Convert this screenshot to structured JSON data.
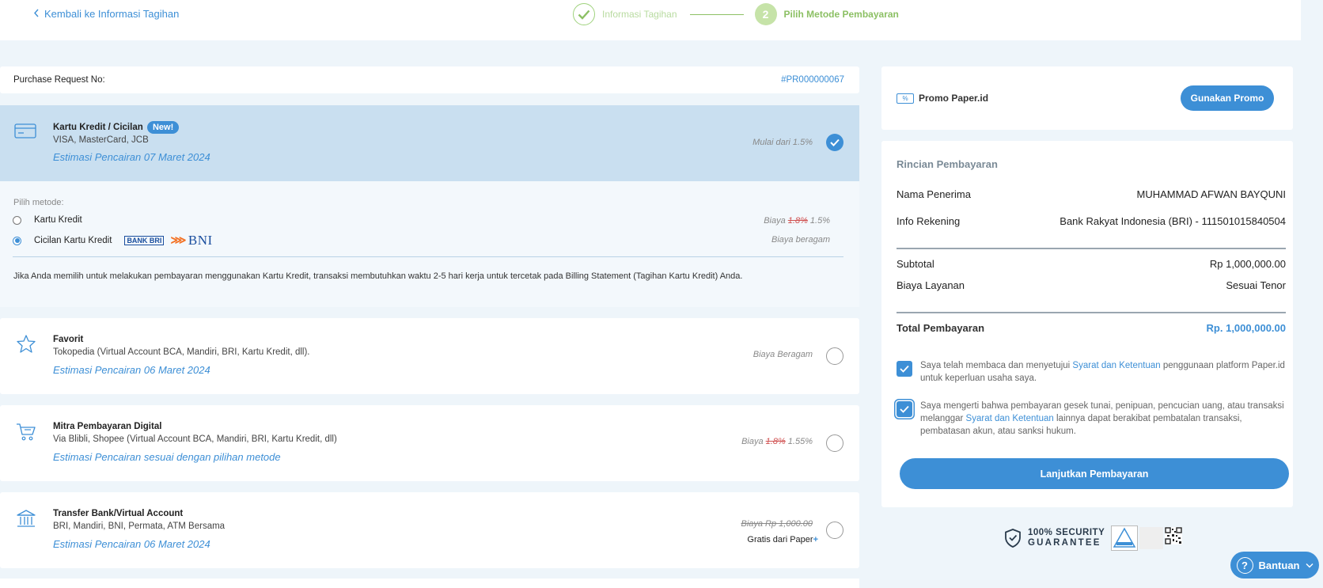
{
  "nav": {
    "back_label": "Kembali ke Informasi Tagihan",
    "step1_label": "Informasi Tagihan",
    "step2_number": "2",
    "step2_label": "Pilih Metode Pembayaran"
  },
  "purchase": {
    "label": "Purchase Request No:",
    "value": "#PR000000067"
  },
  "credit_card": {
    "title": "Kartu Kredit / Cicilan",
    "badge": "New!",
    "subtitle": "VISA, MasterCard, JCB",
    "estimate": "Estimasi Pencairan  07 Maret 2024",
    "fee": "Mulai dari 1.5%",
    "choose_label": "Pilih metode:",
    "option1_label": "Kartu Kredit",
    "option1_fee_prefix": "Biaya",
    "option1_fee_old": "1.8%",
    "option1_fee_new": "1.5%",
    "option2_label": "Cicilan Kartu Kredit",
    "option2_fee": "Biaya beragam",
    "bank_bri": "BANK BRI",
    "bank_bni": "BNI",
    "note": "Jika Anda memilih untuk melakukan pembayaran menggunakan Kartu Kredit, transaksi membutuhkan waktu 2-5 hari kerja untuk tercetak pada Billing Statement (Tagihan Kartu Kredit) Anda."
  },
  "methods": [
    {
      "title": "Favorit",
      "subtitle": "Tokopedia (Virtual Account BCA, Mandiri, BRI, Kartu Kredit, dll).",
      "estimate": "Estimasi Pencairan  06 Maret 2024",
      "fee": "Biaya Beragam"
    },
    {
      "title": "Mitra Pembayaran Digital",
      "subtitle": "Via Blibli, Shopee (Virtual Account BCA, Mandiri, BRI, Kartu Kredit, dll)",
      "estimate": "Estimasi Pencairan sesuai dengan pilihan metode",
      "fee_prefix": "Biaya",
      "fee_old": "1.8%",
      "fee_new": "1.55%"
    },
    {
      "title": "Transfer Bank/Virtual Account",
      "subtitle": "BRI, Mandiri, BNI, Permata, ATM Bersama",
      "estimate": "Estimasi Pencairan  06 Maret 2024",
      "fee_old": "Biaya Rp 1,000.00",
      "gratis_prefix": "Gratis",
      "gratis_suffix": "dari Paper",
      "gratis_plus": "+"
    }
  ],
  "promo": {
    "icon_text": "%",
    "label": "Promo Paper.id",
    "button": "Gunakan Promo"
  },
  "rincian": {
    "title": "Rincian Pembayaran",
    "recipient_label": "Nama Penerima",
    "recipient_value": "MUHAMMAD AFWAN BAYQUNI",
    "account_label": "Info Rekening",
    "account_value": "Bank Rakyat Indonesia (BRI) - 111501015840504",
    "subtotal_label": "Subtotal",
    "subtotal_value": "Rp 1,000,000.00",
    "service_label": "Biaya Layanan",
    "service_value": "Sesuai Tenor",
    "total_label": "Total Pembayaran",
    "total_value": "Rp. 1,000,000.00",
    "agree1_a": "Saya telah membaca dan menyetujui ",
    "agree1_link": "Syarat dan Ketentuan",
    "agree1_b": " penggunaan platform Paper.id untuk keperluan usaha saya.",
    "agree2_a": "Saya mengerti bahwa pembayaran gesek tunai, penipuan, pencucian uang, atau transaksi melanggar ",
    "agree2_link": "Syarat dan Ketentuan",
    "agree2_b": " lainnya dapat berakibat pembatalan transaksi, pembatasan akun, atau sanksi hukum.",
    "button": "Lanjutkan Pembayaran"
  },
  "security": {
    "line1": "100% SECURITY",
    "line2": "GUARANTEE"
  },
  "help": {
    "label": "Bantuan"
  },
  "colors": {
    "accent": "#3d8fd6",
    "step_green": "#8cc064",
    "selected_bg": "#c9dff0",
    "page_bg": "#eef5fa"
  }
}
